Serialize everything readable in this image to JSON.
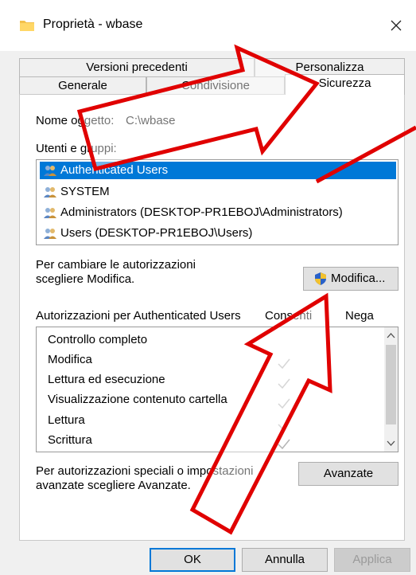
{
  "window": {
    "title": "Proprietà - wbase"
  },
  "tabs": {
    "row1": [
      "Versioni precedenti",
      "Personalizza"
    ],
    "row2": [
      "Generale",
      "Condivisione",
      "Sicurezza"
    ],
    "active": "Sicurezza"
  },
  "object": {
    "label": "Nome oggetto:",
    "value": "C:\\wbase"
  },
  "users": {
    "label": "Utenti e gruppi:",
    "items": [
      "Authenticated Users",
      "SYSTEM",
      "Administrators (DESKTOP-PR1EBOJ\\Administrators)",
      "Users (DESKTOP-PR1EBOJ\\Users)"
    ]
  },
  "edit": {
    "hint_line1": "Per cambiare le autorizzazioni",
    "hint_line2": "scegliere Modifica.",
    "button": "Modifica..."
  },
  "permissions": {
    "header": "Autorizzazioni per Authenticated Users",
    "allow": "Consenti",
    "deny": "Nega",
    "rows": [
      {
        "name": "Controllo completo",
        "allow": false
      },
      {
        "name": "Modifica",
        "allow": true
      },
      {
        "name": "Lettura ed esecuzione",
        "allow": true
      },
      {
        "name": "Visualizzazione contenuto cartella",
        "allow": true
      },
      {
        "name": "Lettura",
        "allow": true
      },
      {
        "name": "Scrittura",
        "allow": true
      }
    ]
  },
  "advanced": {
    "hint_line1": "Per autorizzazioni speciali o impostazioni",
    "hint_line2": "avanzate scegliere Avanzate.",
    "button": "Avanzate"
  },
  "footer": {
    "ok": "OK",
    "cancel": "Annulla",
    "apply": "Applica"
  },
  "colors": {
    "selection": "#0078d7",
    "annotation_arrow": "#e00000"
  }
}
